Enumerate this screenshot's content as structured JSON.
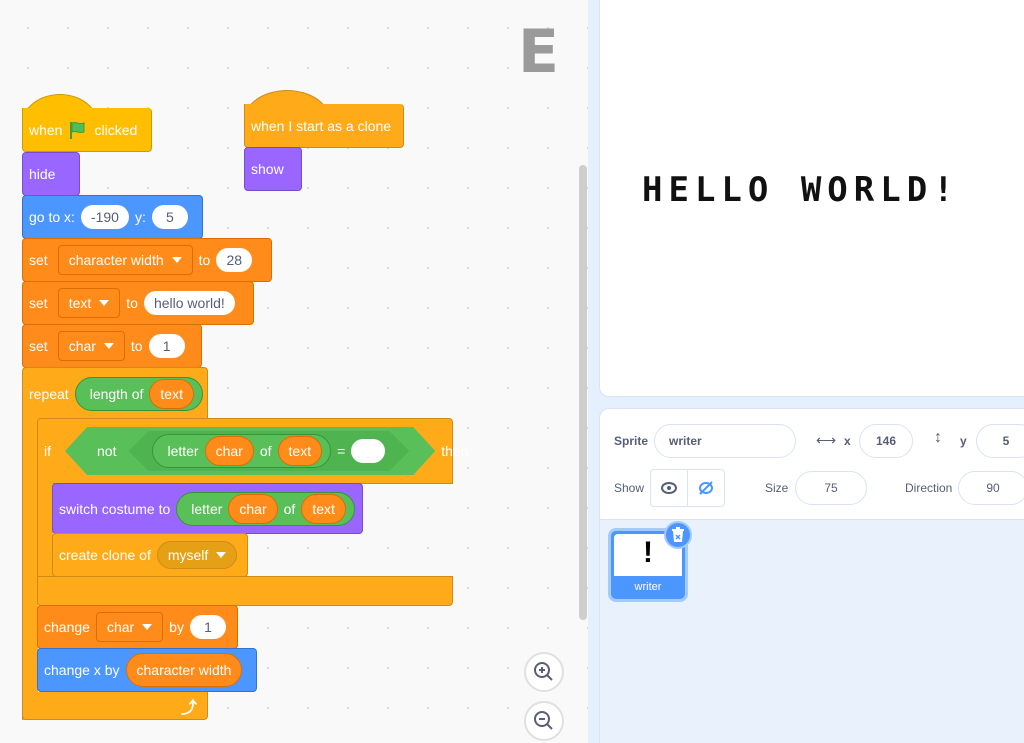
{
  "workspace": {
    "sprite_letter": "E",
    "script1": {
      "hat": {
        "when": "when",
        "icon": "green-flag-icon",
        "clicked": "clicked"
      },
      "hide": "hide",
      "goto": {
        "label": "go to x:",
        "x": "-190",
        "y_label": "y:",
        "y": "5"
      },
      "set1": {
        "label": "set",
        "var": "character width",
        "to": "to",
        "value": "28"
      },
      "set2": {
        "label": "set",
        "var": "text",
        "to": "to",
        "value": "hello world!"
      },
      "set3": {
        "label": "set",
        "var": "char",
        "to": "to",
        "value": "1"
      },
      "repeat": {
        "label": "repeat",
        "length_of": "length of",
        "var": "text"
      },
      "if": {
        "label": "if",
        "not": "not",
        "letter": "letter",
        "char": "char",
        "of": "of",
        "text": "text",
        "eq": "=",
        "value": "",
        "then": "then"
      },
      "switch": {
        "label": "switch costume to",
        "letter": "letter",
        "char": "char",
        "of": "of",
        "text": "text"
      },
      "clone": {
        "label": "create clone of",
        "target": "myself"
      },
      "change1": {
        "label": "change",
        "var": "char",
        "by": "by",
        "value": "1"
      },
      "change2": {
        "label": "change x by",
        "var": "character width"
      }
    },
    "script2": {
      "hat": "when I start as a clone",
      "show": "show"
    }
  },
  "stage": {
    "text": "HELLO WORLD!"
  },
  "sprite_info": {
    "sprite_label": "Sprite",
    "sprite_name": "writer",
    "x_label": "x",
    "x": "146",
    "y_label": "y",
    "y": "5",
    "show_label": "Show",
    "size_label": "Size",
    "size": "75",
    "direction_label": "Direction",
    "direction": "90"
  },
  "sprite_list": [
    {
      "name": "writer",
      "costume": "!"
    }
  ]
}
